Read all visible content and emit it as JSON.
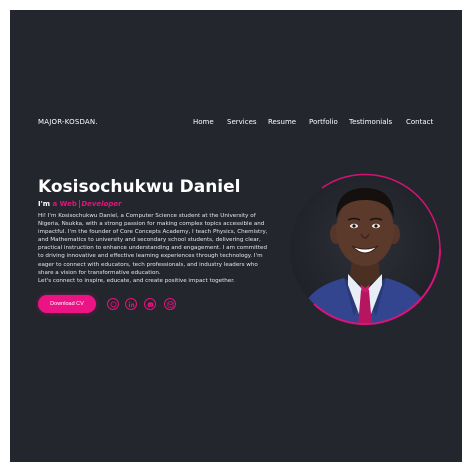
{
  "brand": {
    "logo_text": "MAJOR-KOSDAN."
  },
  "nav": {
    "items": [
      {
        "label": "Home"
      },
      {
        "label": "Services"
      },
      {
        "label": "Resume"
      },
      {
        "label": "Portfolio"
      },
      {
        "label": "Testimonials"
      },
      {
        "label": "Contact"
      }
    ]
  },
  "hero": {
    "name": "Kosisochukwu Daniel",
    "role_prefix": "I'm ",
    "role_accent": "a Web ",
    "role_typed": "Developer",
    "bio_paragraphs": [
      "Hi! I'm Kosisochukwu Daniel, a Computer Science student at the University of Nigeria, Nsukka, with a strong passion for making complex topics accessible and impactful. I'm the founder of Core Concepts Academy, I teach Physics, Chemistry, and Mathematics to university and secondary school students, delivering clear, practical instruction to enhance understanding and engagement. I am committed to driving innovative and effective learning experiences through technology. I'm eager to connect with educators, tech professionals, and industry leaders who share a vision for transformative education.",
      "Let's connect to inspire, educate, and create positive impact together."
    ],
    "cta_label": "Download CV",
    "socials": [
      {
        "icon": "github-icon"
      },
      {
        "icon": "linkedin-icon"
      },
      {
        "icon": "discord-icon"
      },
      {
        "icon": "email-icon"
      }
    ]
  },
  "colors": {
    "background": "#23262d",
    "accent": "#e5127c",
    "text": "#ffffff"
  }
}
